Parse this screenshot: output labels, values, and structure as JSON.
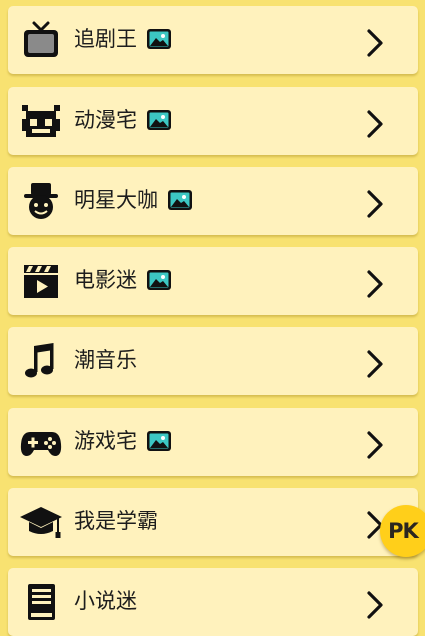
{
  "items": [
    {
      "label": "追剧王",
      "icon": "tv-icon",
      "has_photo_badge": true
    },
    {
      "label": "动漫宅",
      "icon": "pixel-robot-icon",
      "has_photo_badge": true
    },
    {
      "label": "明星大咖",
      "icon": "hat-person-icon",
      "has_photo_badge": true
    },
    {
      "label": "电影迷",
      "icon": "clapperboard-icon",
      "has_photo_badge": true
    },
    {
      "label": "潮音乐",
      "icon": "music-note-icon",
      "has_photo_badge": false
    },
    {
      "label": "游戏宅",
      "icon": "gamepad-icon",
      "has_photo_badge": true
    },
    {
      "label": "我是学霸",
      "icon": "graduation-cap-icon",
      "has_photo_badge": false
    },
    {
      "label": "小说迷",
      "icon": "book-icon",
      "has_photo_badge": false
    }
  ],
  "pk_button": {
    "label": "PK"
  },
  "colors": {
    "background": "#f8e271",
    "card": "#fff2bd",
    "badge": "#3cc7c3",
    "pk": "#ffcf1a"
  }
}
